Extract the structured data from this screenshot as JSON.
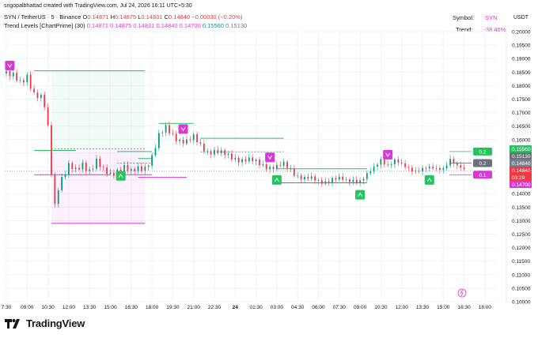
{
  "header": {
    "created_by": "srigopalbhattad created with TradingView.com, Jul 24, 2026 16:11 UTC+5:30"
  },
  "symbol_info": {
    "name": "SYN / TetherUS · 5 · Binance",
    "o_label": "O",
    "o_value": "0.14871",
    "h_label": "H",
    "h_value": "0.14875",
    "l_label": "L",
    "l_value": "0.14831",
    "c_label": "C",
    "c_value": "0.14840",
    "change": "−0.00030 (−0.20%)"
  },
  "indicator": {
    "name": "Trend Levels [ChartPrime] (30)",
    "values": [
      "0.14871",
      "0.14875",
      "0.14831",
      "0.14840",
      "0.14700",
      "0.15560",
      "0.15130"
    ]
  },
  "info_panel": {
    "symbol_label": "Symbol:",
    "symbol_value": "SYN",
    "trend_label": "Trend:",
    "trend_value": "-38.46%"
  },
  "axis": {
    "currency": "USDT"
  },
  "price_tags": [
    {
      "text": "0.15560",
      "color": "#22c55e"
    },
    {
      "text": "0.15130",
      "color": "#6b6f7a"
    },
    {
      "text": "0.14840",
      "color": "#7a7f8c"
    },
    {
      "text": "0.14840",
      "color": "#f23645"
    },
    {
      "text": "03:29",
      "color": "#f23645"
    },
    {
      "text": "0.14700",
      "color": "#d63ad6"
    }
  ],
  "level_labels": [
    {
      "text": "0.2",
      "color": "#22c55e"
    },
    {
      "text": "0.2",
      "color": "#6b6f7a"
    },
    {
      "text": "0.1",
      "color": "#d63ad6"
    }
  ],
  "footer": {
    "logo_text": "TradingView"
  },
  "colors": {
    "up": "#089981",
    "down": "#f23645",
    "level_high": "#22c55e",
    "level_low": "#d63ad6",
    "level_mid": "#787b86"
  },
  "chart_data": {
    "type": "candlestick",
    "y_ticks": [
      "0.20000",
      "0.19500",
      "0.19000",
      "0.18500",
      "0.18000",
      "0.17500",
      "0.17000",
      "0.16500",
      "0.16000",
      "0.15500",
      "0.15000",
      "0.14500",
      "0.14000",
      "0.13500",
      "0.13000",
      "0.12500",
      "0.12000",
      "0.11500",
      "0.11000",
      "0.10500",
      "0.10000"
    ],
    "ylim": [
      0.1,
      0.2
    ],
    "x_ticks": [
      "7:30",
      "09:00",
      "10:30",
      "12:00",
      "13:30",
      "15:00",
      "16:30",
      "18:00",
      "19:30",
      "21:00",
      "22:30",
      "24",
      "01:30",
      "03:00",
      "04:30",
      "06:00",
      "07:30",
      "09:00",
      "10:30",
      "12:00",
      "13:30",
      "15:00",
      "16:30",
      "18:00"
    ],
    "close_series": [
      {
        "t": "07:30",
        "v": 0.1845
      },
      {
        "t": "08:00",
        "v": 0.183
      },
      {
        "t": "08:30",
        "v": 0.181
      },
      {
        "t": "09:00",
        "v": 0.184
      },
      {
        "t": "09:30",
        "v": 0.177
      },
      {
        "t": "10:00",
        "v": 0.175
      },
      {
        "t": "10:15",
        "v": 0.172
      },
      {
        "t": "10:30",
        "v": 0.164
      },
      {
        "t": "10:45",
        "v": 0.148
      },
      {
        "t": "11:00",
        "v": 0.136
      },
      {
        "t": "11:15",
        "v": 0.143
      },
      {
        "t": "11:30",
        "v": 0.146
      },
      {
        "t": "12:00",
        "v": 0.15
      },
      {
        "t": "12:30",
        "v": 0.148
      },
      {
        "t": "13:00",
        "v": 0.151
      },
      {
        "t": "13:30",
        "v": 0.149
      },
      {
        "t": "14:00",
        "v": 0.152
      },
      {
        "t": "14:30",
        "v": 0.148
      },
      {
        "t": "15:00",
        "v": 0.147
      },
      {
        "t": "15:30",
        "v": 0.149
      },
      {
        "t": "16:00",
        "v": 0.15
      },
      {
        "t": "16:30",
        "v": 0.1475
      },
      {
        "t": "17:00",
        "v": 0.149
      },
      {
        "t": "17:30",
        "v": 0.15
      },
      {
        "t": "18:00",
        "v": 0.154
      },
      {
        "t": "18:30",
        "v": 0.161
      },
      {
        "t": "19:00",
        "v": 0.164
      },
      {
        "t": "19:30",
        "v": 0.162
      },
      {
        "t": "20:00",
        "v": 0.16
      },
      {
        "t": "20:30",
        "v": 0.159
      },
      {
        "t": "21:00",
        "v": 0.1605
      },
      {
        "t": "21:30",
        "v": 0.158
      },
      {
        "t": "22:00",
        "v": 0.156
      },
      {
        "t": "22:30",
        "v": 0.1555
      },
      {
        "t": "23:00",
        "v": 0.1545
      },
      {
        "t": "23:30",
        "v": 0.154
      },
      {
        "t": "00:00",
        "v": 0.1535
      },
      {
        "t": "00:30",
        "v": 0.1525
      },
      {
        "t": "01:00",
        "v": 0.152
      },
      {
        "t": "01:30",
        "v": 0.1515
      },
      {
        "t": "02:00",
        "v": 0.151
      },
      {
        "t": "02:30",
        "v": 0.15
      },
      {
        "t": "03:00",
        "v": 0.1495
      },
      {
        "t": "03:30",
        "v": 0.1505
      },
      {
        "t": "04:00",
        "v": 0.149
      },
      {
        "t": "04:30",
        "v": 0.147
      },
      {
        "t": "05:00",
        "v": 0.1455
      },
      {
        "t": "05:30",
        "v": 0.145
      },
      {
        "t": "06:00",
        "v": 0.1445
      },
      {
        "t": "06:30",
        "v": 0.145
      },
      {
        "t": "07:00",
        "v": 0.1455
      },
      {
        "t": "07:30",
        "v": 0.145
      },
      {
        "t": "08:00",
        "v": 0.1445
      },
      {
        "t": "08:30",
        "v": 0.1455
      },
      {
        "t": "09:00",
        "v": 0.145
      },
      {
        "t": "09:30",
        "v": 0.1465
      },
      {
        "t": "10:00",
        "v": 0.149
      },
      {
        "t": "10:30",
        "v": 0.153
      },
      {
        "t": "11:00",
        "v": 0.151
      },
      {
        "t": "11:30",
        "v": 0.152
      },
      {
        "t": "12:00",
        "v": 0.15
      },
      {
        "t": "12:30",
        "v": 0.1495
      },
      {
        "t": "13:00",
        "v": 0.149
      },
      {
        "t": "13:30",
        "v": 0.1492
      },
      {
        "t": "14:00",
        "v": 0.1488
      },
      {
        "t": "14:30",
        "v": 0.149
      },
      {
        "t": "15:00",
        "v": 0.15
      },
      {
        "t": "15:30",
        "v": 0.153
      },
      {
        "t": "16:00",
        "v": 0.1495
      },
      {
        "t": "16:30",
        "v": 0.1484
      }
    ],
    "levels": [
      {
        "kind": "high",
        "from": "07:30",
        "to": "08:00",
        "value": 0.187
      },
      {
        "kind": "high",
        "from": "09:30",
        "to": "17:30",
        "value": 0.1855
      },
      {
        "kind": "mid",
        "from": "10:45",
        "to": "17:30",
        "value": 0.1565
      },
      {
        "kind": "low",
        "from": "10:45",
        "to": "17:30",
        "value": 0.129
      },
      {
        "kind": "high",
        "from": "17:00",
        "to": "18:00",
        "value": 0.153
      },
      {
        "kind": "low",
        "from": "17:00",
        "to": "20:30",
        "value": 0.146
      },
      {
        "kind": "high",
        "from": "18:30",
        "to": "21:00",
        "value": 0.166
      },
      {
        "kind": "high",
        "from": "21:30",
        "to": "03:30",
        "value": 0.1605
      },
      {
        "kind": "mid",
        "from": "21:30",
        "to": "03:30",
        "value": 0.1555
      },
      {
        "kind": "high",
        "from": "03:00",
        "to": "09:30",
        "value": 0.1492
      },
      {
        "kind": "low",
        "from": "03:00",
        "to": "09:30",
        "value": 0.144
      },
      {
        "kind": "high",
        "from": "09:30",
        "to": "12:30",
        "value": 0.156
      },
      {
        "kind": "low",
        "from": "09:30",
        "to": "15:00",
        "value": 0.147
      },
      {
        "kind": "high",
        "from": "15:30",
        "to": "18:00",
        "value": 0.1556
      },
      {
        "kind": "mid",
        "from": "15:30",
        "to": "18:00",
        "value": 0.1513
      },
      {
        "kind": "low",
        "from": "15:30",
        "to": "18:00",
        "value": 0.147
      }
    ],
    "markers": [
      {
        "kind": "down",
        "t": "07:45",
        "v": 0.1845
      },
      {
        "kind": "up",
        "t": "15:45",
        "v": 0.1495
      },
      {
        "kind": "down",
        "t": "20:15",
        "v": 0.161
      },
      {
        "kind": "down",
        "t": "02:30",
        "v": 0.1505
      },
      {
        "kind": "up",
        "t": "03:00",
        "v": 0.148
      },
      {
        "kind": "up",
        "t": "09:00",
        "v": 0.1425
      },
      {
        "kind": "down",
        "t": "11:00",
        "v": 0.1515
      },
      {
        "kind": "up",
        "t": "14:00",
        "v": 0.148
      }
    ]
  }
}
